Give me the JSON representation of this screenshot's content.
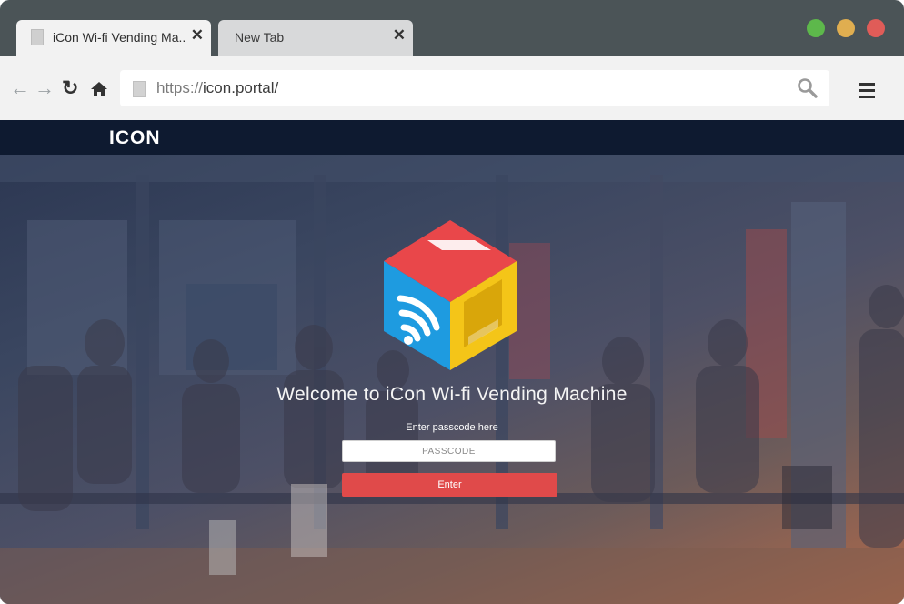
{
  "browser": {
    "tabs": [
      {
        "label": "iCon Wi-fi Vending Ma..",
        "active": true
      },
      {
        "label": "New Tab",
        "active": false
      }
    ],
    "close_glyph": "✕",
    "traffic_lights": [
      "#5db84b",
      "#e0ae50",
      "#e05c58"
    ],
    "nav": {
      "back": "←",
      "forward": "→",
      "reload": "↻",
      "home": "⌂"
    },
    "address": {
      "protocol": "https://",
      "host": "icon.portal/"
    }
  },
  "site": {
    "logo": "ICON",
    "welcome": "Welcome to iCon Wi-fi Vending Machine",
    "passcode_label": "Enter passcode here",
    "passcode_placeholder": "PASSCODE",
    "enter_label": "Enter",
    "colors": {
      "header": "#0e1a30",
      "button": "#e04a4a",
      "cube_blue": "#1e9be0",
      "cube_yellow": "#f4c518",
      "cube_red": "#e9474a"
    }
  }
}
